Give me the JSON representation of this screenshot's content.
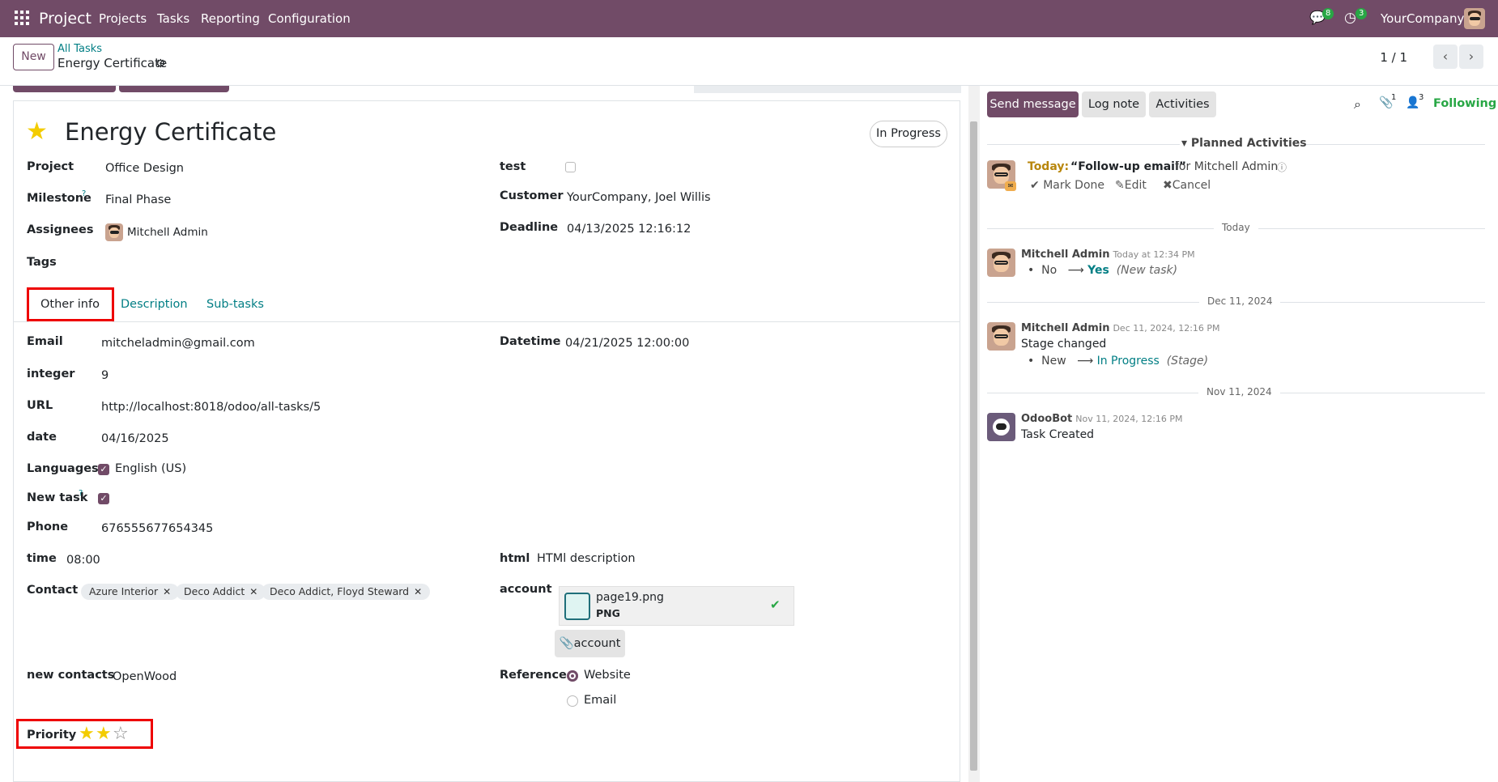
{
  "topbar": {
    "app": "Project",
    "menus": [
      "Projects",
      "Tasks",
      "Reporting",
      "Configuration"
    ],
    "chat_badge": "8",
    "activity_badge": "3",
    "company": "YourCompany"
  },
  "control": {
    "new_label": "New",
    "breadcrumb_parent": "All Tasks",
    "breadcrumb_current": "Energy Certificate",
    "pager": "1 / 1"
  },
  "task": {
    "title": "Energy Certificate",
    "status": "In Progress",
    "fields": {
      "project_label": "Project",
      "project": "Office Design",
      "milestone_label": "Milestone",
      "milestone": "Final Phase",
      "assignees_label": "Assignees",
      "assignee": "Mitchell Admin",
      "tags_label": "Tags",
      "test_label": "test",
      "customer_label": "Customer",
      "customer": "YourCompany, Joel Willis",
      "deadline_label": "Deadline",
      "deadline": "04/13/2025 12:16:12"
    },
    "tabs": [
      "Other info",
      "Description",
      "Sub-tasks"
    ],
    "other": {
      "email_label": "Email",
      "email": "mitcheladmin@gmail.com",
      "integer_label": "integer",
      "integer": "9",
      "url_label": "URL",
      "url": "http://localhost:8018/odoo/all-tasks/5",
      "date_label": "date",
      "date": "04/16/2025",
      "languages_label": "Languages",
      "language": "English (US)",
      "newtask_label": "New task",
      "phone_label": "Phone",
      "phone": "676555677654345",
      "time_label": "time",
      "time": "08:00",
      "contact_label": "Contact",
      "contacts": [
        "Azure Interior",
        "Deco Addict",
        "Deco Addict, Floyd Steward"
      ],
      "newcontacts_label": "new contacts",
      "newcontacts": "OpenWood",
      "priority_label": "Priority",
      "priority_value": 2,
      "priority_max": 3,
      "datetime_label": "Datetime",
      "datetime": "04/21/2025 12:00:00",
      "html_label": "html",
      "html": "HTMl description",
      "account_label": "account",
      "file_name": "page19.png",
      "file_type": "PNG",
      "account_button": "account",
      "reference_label": "Reference",
      "ref_options": [
        "Website",
        "Email"
      ]
    }
  },
  "chatter": {
    "send": "Send message",
    "log": "Log note",
    "activities": "Activities",
    "attachments_count": "1",
    "followers_count": "3",
    "following": "Following",
    "planned_header": "Planned Activities",
    "planned": {
      "when": "Today:",
      "what": "“Follow-up email”",
      "for": "for Mitchell Admin",
      "mark_done": "Mark Done",
      "edit": "Edit",
      "cancel": "Cancel"
    },
    "sep_today": "Today",
    "msg1": {
      "author": "Mitchell Admin",
      "date": "Today at 12:34 PM",
      "old": "No",
      "new": "Yes",
      "field": "(New task)"
    },
    "sep_dec": "Dec 11, 2024",
    "msg2": {
      "author": "Mitchell Admin",
      "date": "Dec 11, 2024, 12:16 PM",
      "body": "Stage changed",
      "old": "New",
      "new": "In Progress",
      "field": "(Stage)"
    },
    "sep_nov": "Nov 11, 2024",
    "msg3": {
      "author": "OdooBot",
      "date": "Nov 11, 2024, 12:16 PM",
      "body": "Task Created"
    }
  },
  "colors": {
    "brand": "#714b67",
    "teal": "#017e84",
    "star": "#f3cc00",
    "highlight": "#e00000"
  }
}
